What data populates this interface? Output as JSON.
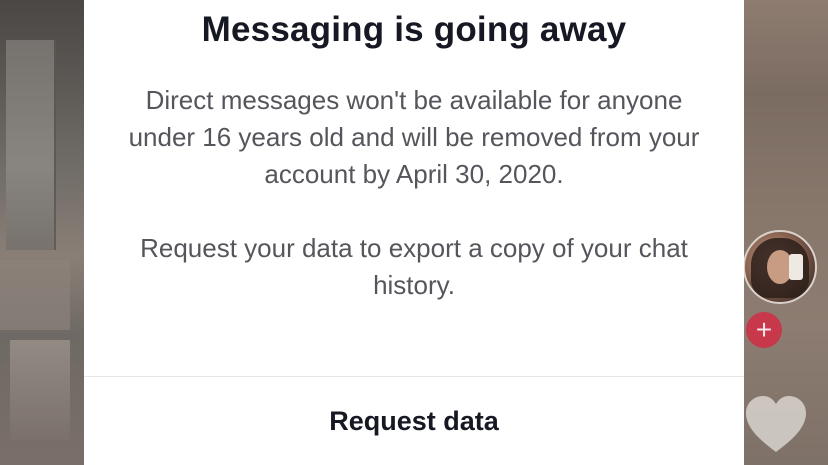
{
  "modal": {
    "title": "Messaging is going away",
    "paragraphs": [
      "Direct messages won't be available for anyone under 16 years old and will be removed from your account by April 30, 2020.",
      "Request your data to export a copy of your chat history."
    ],
    "primary_action": "Request data"
  },
  "sidebar": {
    "follow_symbol": "+",
    "icons": [
      "avatar",
      "plus-icon",
      "heart-icon"
    ]
  },
  "colors": {
    "modal_background": "#ffffff",
    "title_text": "#161823",
    "body_text": "#55565c",
    "follow_button": "#c6384a"
  }
}
